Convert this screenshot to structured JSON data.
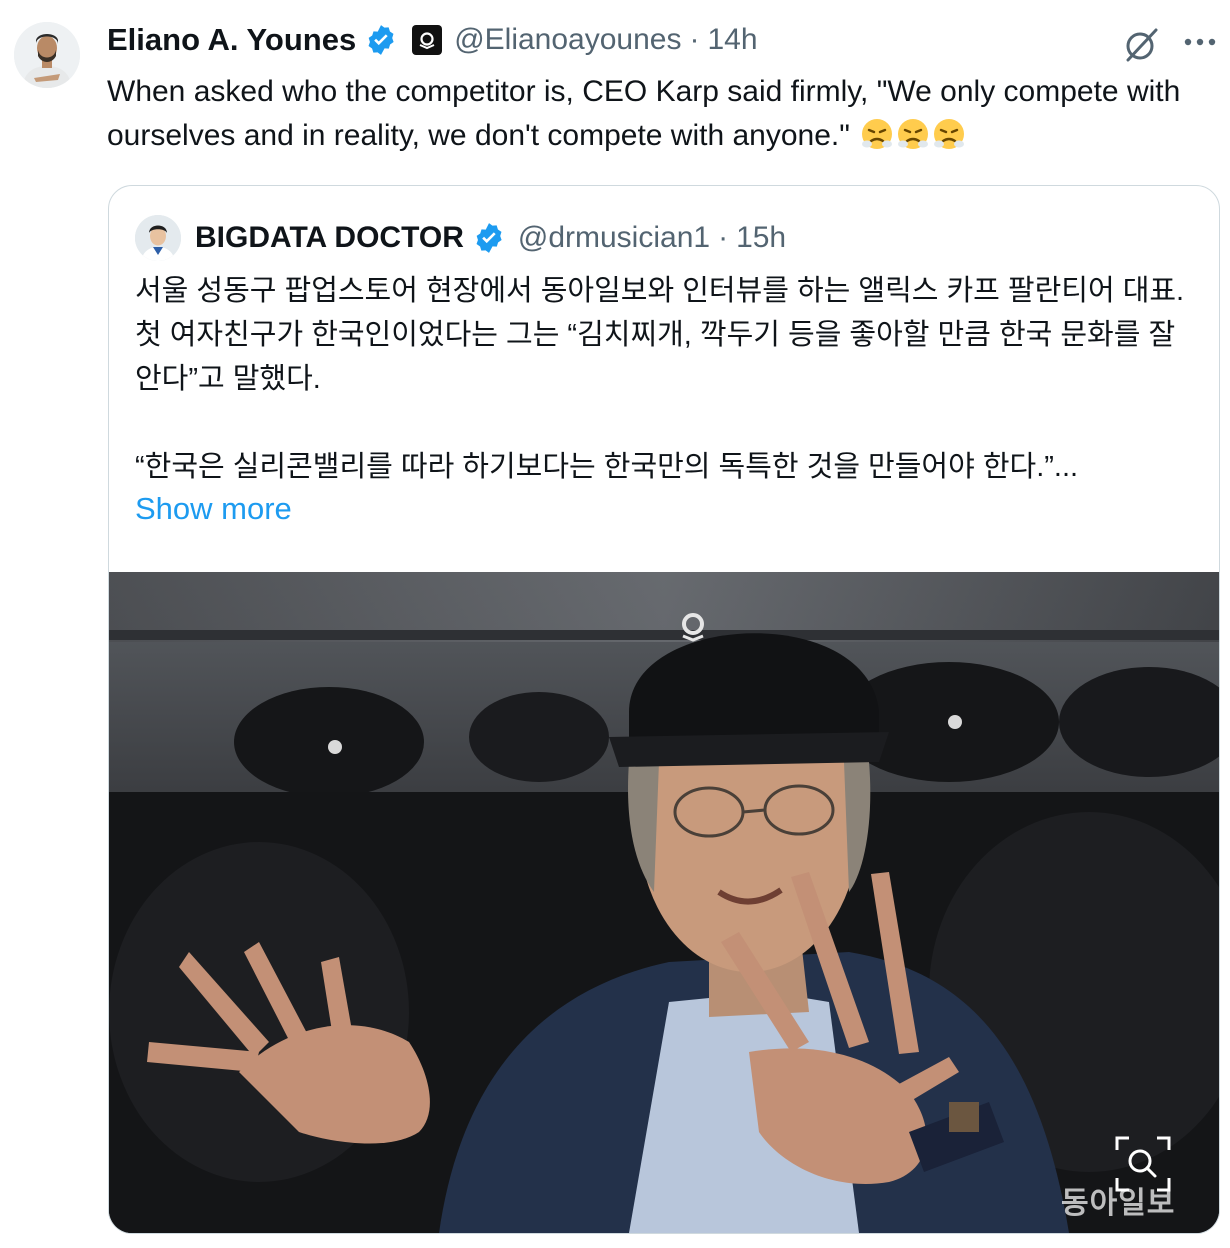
{
  "author": {
    "name": "Eliano A. Younes",
    "handle": "@Elianoayounes",
    "time": "14h"
  },
  "tweet": {
    "text": "When asked who the competitor is, CEO Karp said firmly, \"We only compete with ourselves and in reality, we don't compete with anyone.\""
  },
  "quoted": {
    "name": "BIGDATA DOCTOR",
    "handle": "@drmusician1",
    "time": "15h",
    "paragraph1": "서울 성동구 팝업스토어 현장에서 동아일보와 인터뷰를 하는 앨릭스 카프 팔란티어 대표. 첫 여자친구가 한국인이었다는 그는 “김치찌개, 깍두기 등을 좋아할 만큼 한국 문화를 잘 안다”고 말했다.",
    "paragraph2": "“한국은 실리콘밸리를 따라 하기보다는 한국만의 독특한 것을 만들어야 한다.”...",
    "show_more": "Show more",
    "watermark": "동아일보"
  },
  "icons": {
    "verified": "verified-badge-icon",
    "affiliate": "affiliate-badge-icon",
    "grok": "grok-icon",
    "more": "more-icon",
    "emoji": "steam-from-nose-emoji",
    "zoom": "zoom-icon"
  },
  "colors": {
    "link": "#1d9bf0",
    "secondary_text": "#536471",
    "border": "#cfd9de",
    "verified": "#1d9bf0"
  }
}
